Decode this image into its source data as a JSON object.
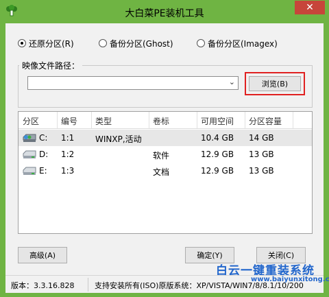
{
  "window": {
    "title": "大白菜PE装机工具",
    "close_symbol": "✕",
    "accent": "#6fb443"
  },
  "modes": [
    {
      "label": "还原分区(R)",
      "checked": true
    },
    {
      "label": "备份分区(Ghost)",
      "checked": false
    },
    {
      "label": "备份分区(Imagex)",
      "checked": false
    }
  ],
  "image_path": {
    "label": "映像文件路径：",
    "value": "",
    "dropdown_arrow": "⌄",
    "browse_label": "浏览(B)"
  },
  "partitions": {
    "columns": [
      "分区",
      "编号",
      "类型",
      "卷标",
      "可用空间",
      "分区容量"
    ],
    "rows": [
      {
        "drive": "C:",
        "number": "1:1",
        "type": "WINXP,活动",
        "label": "",
        "free": "10.4 GB",
        "capacity": "14 GB"
      },
      {
        "drive": "D:",
        "number": "1:2",
        "type": "",
        "label": "软件",
        "free": "12.9 GB",
        "capacity": "13 GB"
      },
      {
        "drive": "E:",
        "number": "1:3",
        "type": "",
        "label": "文档",
        "free": "12.9 GB",
        "capacity": "13 GB"
      }
    ]
  },
  "buttons": {
    "advanced": "高级(A)",
    "ok": "确定(Y)",
    "close": "关闭(C)"
  },
  "status": {
    "version": "版本：3.3.16.828",
    "support": "支持安装所有(ISO)原版系统：XP/VISTA/WIN7/8/8.1/10/200"
  },
  "watermark": {
    "text": "白云一键重装系统",
    "url": "www.baiyunxitong.com"
  }
}
